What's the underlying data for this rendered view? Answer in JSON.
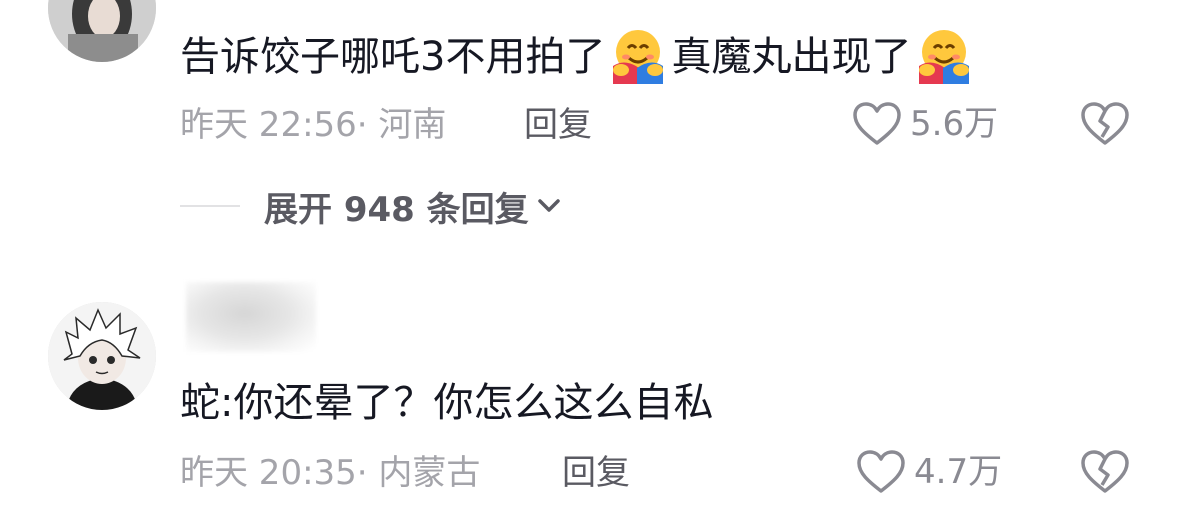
{
  "comments": [
    {
      "text_part1": "告诉饺子哪吒3不用拍了",
      "text_part2": "真魔丸出现了",
      "emoji_icon": "hugging-face-emoji",
      "time": "昨天 22:56",
      "location": "· 河南",
      "reply_label": "回复",
      "likes": "5.6万"
    },
    {
      "text": "蛇:你还晕了？你怎么这么自私",
      "time": "昨天 20:35",
      "location": "· 内蒙古",
      "reply_label": "回复",
      "likes": "4.7万"
    }
  ],
  "expand_replies": {
    "label": "展开 948 条回复"
  },
  "colors": {
    "text": "#161823",
    "meta": "#a4a4aa",
    "secondary": "#5a5a62",
    "icon": "#8a8a92"
  }
}
